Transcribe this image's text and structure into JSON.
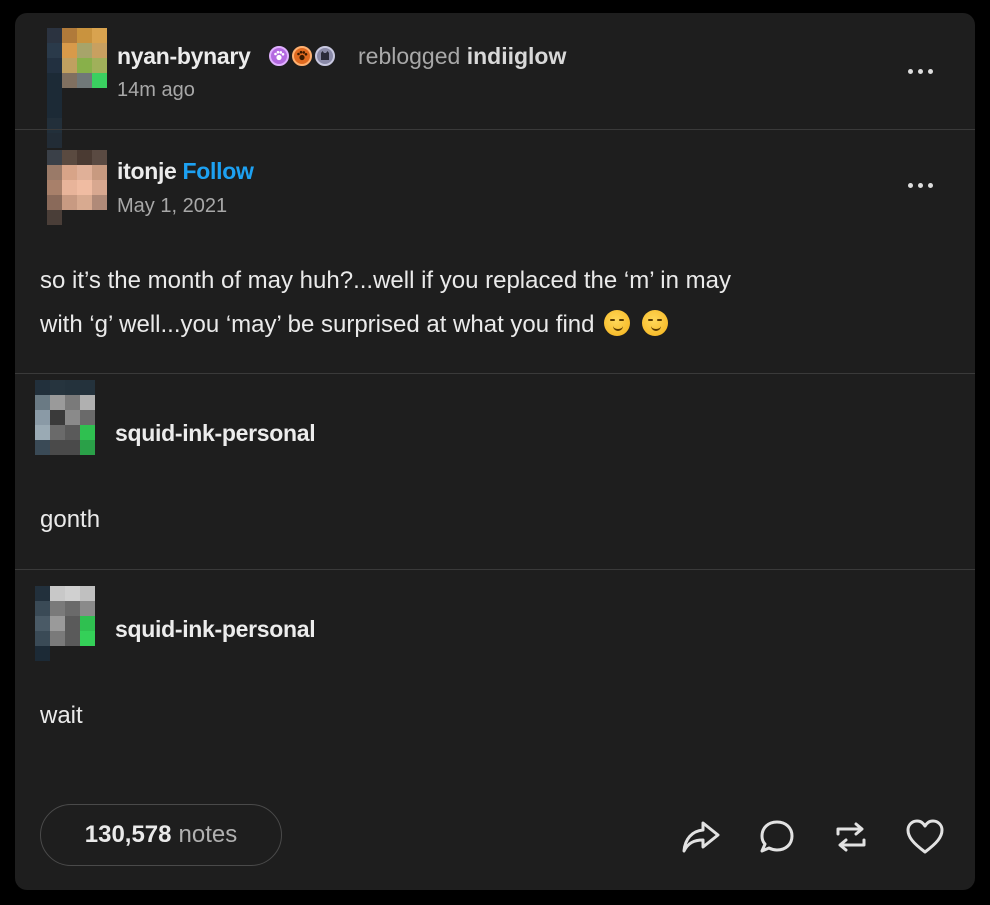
{
  "colors": {
    "background": "#000000",
    "card": "#1e1e1e",
    "divider": "#3a3a3a",
    "follow": "#1da1f2",
    "muted": "#a8a8a8",
    "text": "#eaeaea"
  },
  "header": {
    "username": "nyan-bynary",
    "badges": [
      "paw-badge-icon",
      "paw-badge-icon",
      "cat-badge-icon"
    ],
    "reblog_text": "reblogged",
    "reblogged_from": "indiiglow",
    "time": "14m ago",
    "menu_icon": "more-options-icon"
  },
  "original_post": {
    "username": "itonje",
    "follow_label": "Follow",
    "date": "May 1, 2021",
    "text_line1": "so it’s the month of may huh?...well if you replaced the ‘m’ in may",
    "text_line2": "with ‘g’ well...you ‘may’ be surprised at what you find",
    "emojis": [
      "smirk-emoji-icon",
      "smirk-emoji-icon"
    ]
  },
  "reblogs": [
    {
      "username": "squid-ink-personal",
      "text": "gonth"
    },
    {
      "username": "squid-ink-personal",
      "text": "wait"
    }
  ],
  "footer": {
    "notes_count": "130,578",
    "notes_label": "notes",
    "actions": [
      "share-icon",
      "reply-icon",
      "reblog-icon",
      "like-icon"
    ]
  }
}
